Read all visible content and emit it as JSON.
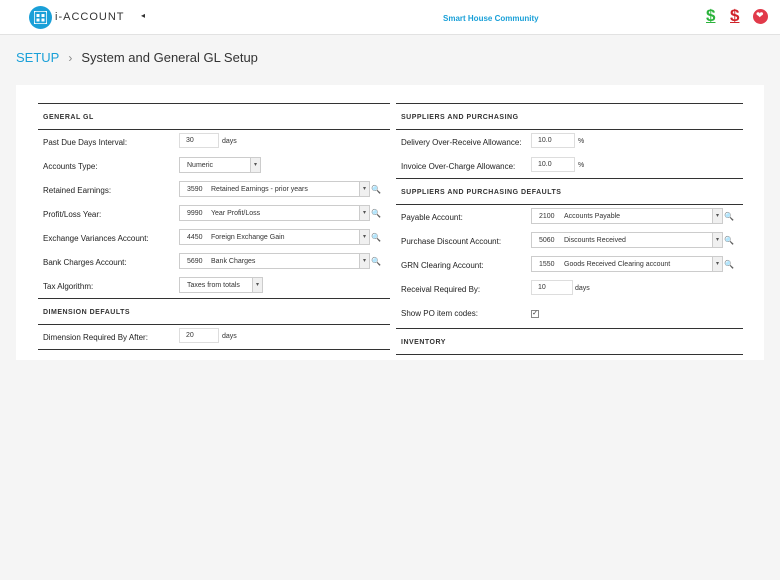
{
  "header": {
    "logo_text": "i-ACCOUNT",
    "collapse_glyph": "◂",
    "community": "Smart House Community",
    "icons": [
      "money-green-icon",
      "money-red-icon",
      "heart-icon"
    ]
  },
  "breadcrumb": {
    "root": "SETUP",
    "separator": "›",
    "title": "System and General GL Setup"
  },
  "general_gl": {
    "heading": "GENERAL GL",
    "past_due": {
      "label": "Past Due Days Interval:",
      "value": "30",
      "unit": "days"
    },
    "accounts_type": {
      "label": "Accounts Type:",
      "value": "Numeric"
    },
    "retained": {
      "label": "Retained Earnings:",
      "code": "3590",
      "name": "Retained Earnings - prior years"
    },
    "profit_loss": {
      "label": "Profit/Loss Year:",
      "code": "9990",
      "name": "Year Profit/Loss"
    },
    "exchange": {
      "label": "Exchange Variances Account:",
      "code": "4450",
      "name": "Foreign Exchange Gain"
    },
    "bank": {
      "label": "Bank Charges Account:",
      "code": "5690",
      "name": "Bank Charges"
    },
    "tax": {
      "label": "Tax Algorithm:",
      "value": "Taxes from totals"
    }
  },
  "dimension": {
    "heading": "DIMENSION DEFAULTS",
    "required": {
      "label": "Dimension Required By After:",
      "value": "20",
      "unit": "days"
    }
  },
  "suppliers": {
    "heading": "SUPPLIERS AND PURCHASING",
    "delivery": {
      "label": "Delivery Over-Receive Allowance:",
      "value": "10.0",
      "unit": "%"
    },
    "invoice": {
      "label": "Invoice Over-Charge Allowance:",
      "value": "10.0",
      "unit": "%"
    }
  },
  "supplier_defaults": {
    "heading": "SUPPLIERS AND PURCHASING DEFAULTS",
    "payable": {
      "label": "Payable Account:",
      "code": "2100",
      "name": "Accounts Payable"
    },
    "discount": {
      "label": "Purchase Discount Account:",
      "code": "5060",
      "name": "Discounts Received"
    },
    "grn": {
      "label": "GRN Clearing Account:",
      "code": "1550",
      "name": "Goods Received Clearing account"
    },
    "receival": {
      "label": "Receival Required By:",
      "value": "10",
      "unit": "days"
    },
    "show_po": {
      "label": "Show PO item codes:",
      "checked": "✓"
    }
  },
  "inventory": {
    "heading": "INVENTORY"
  },
  "glyphs": {
    "dropdown": "▾",
    "search": "🔍"
  }
}
